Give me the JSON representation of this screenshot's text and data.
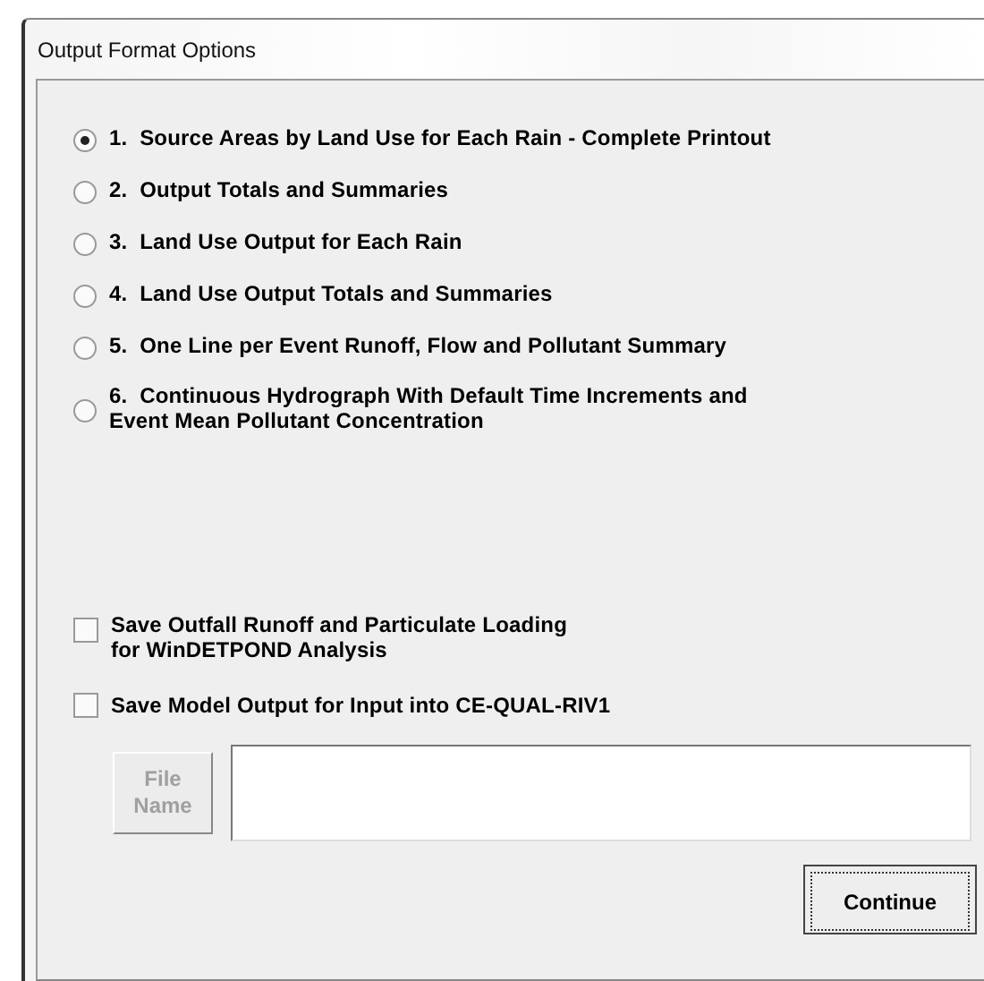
{
  "window": {
    "title": "Output Format Options"
  },
  "options": [
    {
      "label": "1.  Source Areas by Land Use for Each Rain - Complete Printout",
      "selected": true
    },
    {
      "label": "2.  Output Totals and Summaries",
      "selected": false
    },
    {
      "label": "3.  Land Use Output for Each Rain",
      "selected": false
    },
    {
      "label": "4.  Land Use Output Totals and Summaries",
      "selected": false
    },
    {
      "label": "5.  One Line per Event Runoff, Flow and Pollutant Summary",
      "selected": false
    },
    {
      "label": "6.  Continuous Hydrograph With Default Time Increments and\nEvent Mean Pollutant Concentration",
      "selected": false
    }
  ],
  "checkboxes": [
    {
      "label": "Save Outfall Runoff and Particulate Loading\nfor WinDETPOND Analysis",
      "checked": false
    },
    {
      "label": "Save Model Output for Input into CE-QUAL-RIV1",
      "checked": false
    }
  ],
  "file_name_button": {
    "label": "File\nName",
    "disabled": true
  },
  "continue_button": {
    "label": "Continue"
  }
}
